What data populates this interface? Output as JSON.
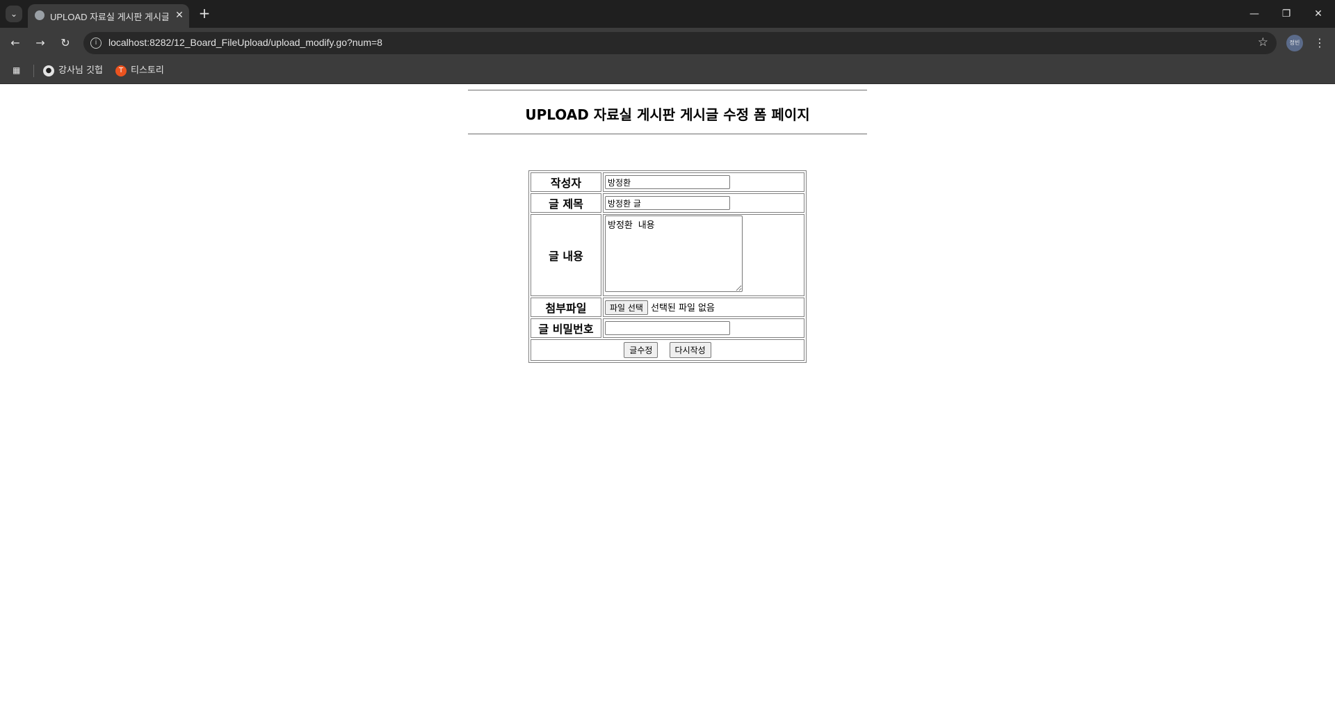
{
  "browser": {
    "tab_title": "UPLOAD 자료실 게시판 게시글",
    "url": "localhost:8282/12_Board_FileUpload/upload_modify.go?num=8",
    "profile_label": "정빈",
    "bookmarks": [
      {
        "label": "강사님 깃헙",
        "icon": "github-icon"
      },
      {
        "label": "티스토리",
        "icon": "tistory-icon"
      }
    ]
  },
  "page": {
    "title": "UPLOAD 자료실 게시판 게시글 수정 폼 페이지",
    "form": {
      "writer_label": "작성자",
      "writer_value": "방정환",
      "subject_label": "글 제목",
      "subject_value": "방정환 글",
      "content_label": "글 내용",
      "content_value": "방정환 내용",
      "file_label": "첨부파일",
      "file_button": "파일 선택",
      "file_status": "선택된 파일 없음",
      "password_label": "글 비밀번호",
      "password_value": "",
      "submit_label": "글수정",
      "reset_label": "다시작성"
    }
  }
}
